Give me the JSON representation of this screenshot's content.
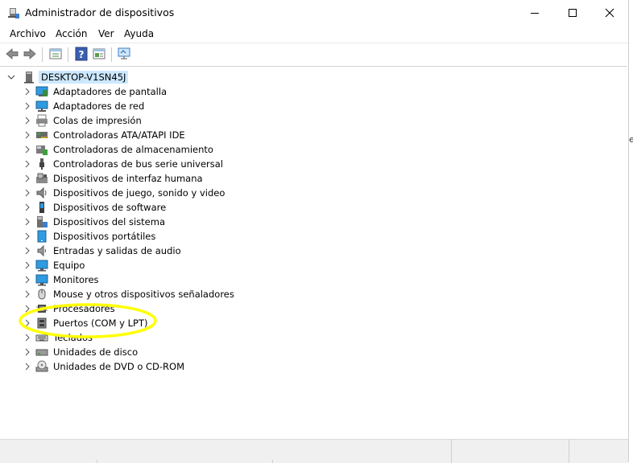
{
  "window": {
    "title": "Administrador de dispositivos",
    "controls": [
      "minimize",
      "maximize",
      "close"
    ]
  },
  "menu": [
    "Archivo",
    "Acción",
    "Ver",
    "Ayuda"
  ],
  "toolbar": {
    "icons": [
      "back-arrow-icon",
      "forward-arrow-icon",
      "properties-icon",
      "help-icon",
      "details-pane-icon",
      "scan-hardware-icon"
    ]
  },
  "tree": {
    "root": "DESKTOP-V1SN45J",
    "items": [
      {
        "label": "Adaptadores de pantalla",
        "icon": "display-adapter-icon"
      },
      {
        "label": "Adaptadores de red",
        "icon": "network-adapter-icon"
      },
      {
        "label": "Colas de impresión",
        "icon": "print-queue-icon"
      },
      {
        "label": "Controladoras ATA/ATAPI IDE",
        "icon": "ide-controller-icon"
      },
      {
        "label": "Controladoras de almacenamiento",
        "icon": "storage-controller-icon"
      },
      {
        "label": "Controladoras de bus serie universal",
        "icon": "usb-icon"
      },
      {
        "label": "Dispositivos de interfaz humana",
        "icon": "hid-icon"
      },
      {
        "label": "Dispositivos de juego, sonido y video",
        "icon": "speaker-icon"
      },
      {
        "label": "Dispositivos de software",
        "icon": "software-device-icon"
      },
      {
        "label": "Dispositivos del sistema",
        "icon": "system-device-icon"
      },
      {
        "label": "Dispositivos portátiles",
        "icon": "portable-device-icon"
      },
      {
        "label": "Entradas y salidas de audio",
        "icon": "audio-io-icon"
      },
      {
        "label": "Equipo",
        "icon": "computer-icon"
      },
      {
        "label": "Monitores",
        "icon": "monitor-icon"
      },
      {
        "label": "Mouse y otros dispositivos señaladores",
        "icon": "mouse-icon"
      },
      {
        "label": "Procesadores",
        "icon": "processor-icon"
      },
      {
        "label": "Puertos (COM y LPT)",
        "icon": "port-icon"
      },
      {
        "label": "Teclados",
        "icon": "keyboard-icon"
      },
      {
        "label": "Unidades de disco",
        "icon": "disk-drive-icon"
      },
      {
        "label": "Unidades de DVD o CD-ROM",
        "icon": "dvd-drive-icon"
      }
    ]
  },
  "annotation": {
    "color": "#ffff00",
    "target": "Puertos (COM y LPT)"
  },
  "colors": {
    "selection": "#cce8ff",
    "monitor_blue": "#2f9be0"
  }
}
